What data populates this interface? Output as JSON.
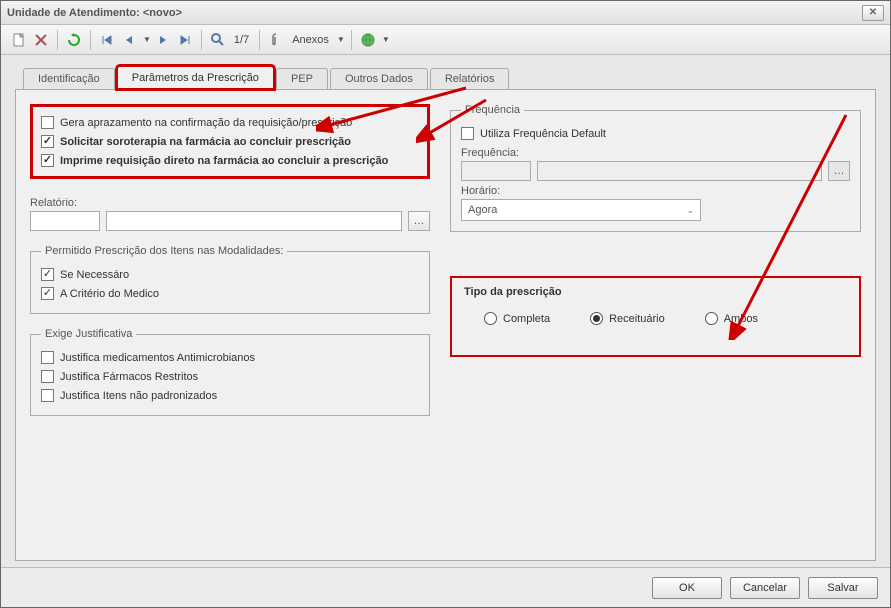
{
  "window": {
    "title": "Unidade de Atendimento: <novo>"
  },
  "toolbar": {
    "page_indicator": "1/7",
    "anexos": "Anexos"
  },
  "tabs": {
    "identificacao": "Identificação",
    "parametros": "Parâmetros da Prescrição",
    "pep": "PEP",
    "outros": "Outros Dados",
    "relatorios": "Relatórios"
  },
  "left": {
    "group1": {
      "gera_aprazamento": "Gera aprazamento na confirmação da requisição/prescrição",
      "solicitar_soroterapia": "Solicitar soroterapia na farmácia ao concluir prescrição",
      "imprime_requisicao": "Imprime requisição direto na farmácia ao concluir a prescrição"
    },
    "relatorio_label": "Relatório:",
    "modalidades": {
      "legend": "Permitido Prescrição dos Itens nas Modalidades:",
      "se_necessario": "Se Necessáro",
      "a_criterio": "A Critério do Medico"
    },
    "justificativa": {
      "legend": "Exige Justificativa",
      "antimicrobianos": "Justifica medicamentos Antimicrobianos",
      "restritos": "Justifica Fármacos Restritos",
      "nao_padronizados": "Justifica Itens não padronizados"
    }
  },
  "right": {
    "frequencia": {
      "legend": "Frequência",
      "utiliza_default": "Utiliza Frequência Default",
      "frequencia_label": "Frequência:",
      "horario_label": "Horário:",
      "horario_valor": "Agora"
    },
    "tipo": {
      "legend": "Tipo da prescrição",
      "completa": "Completa",
      "receituario": "Receituário",
      "ambos": "Ambos"
    }
  },
  "footer": {
    "ok": "OK",
    "cancelar": "Cancelar",
    "salvar": "Salvar"
  }
}
